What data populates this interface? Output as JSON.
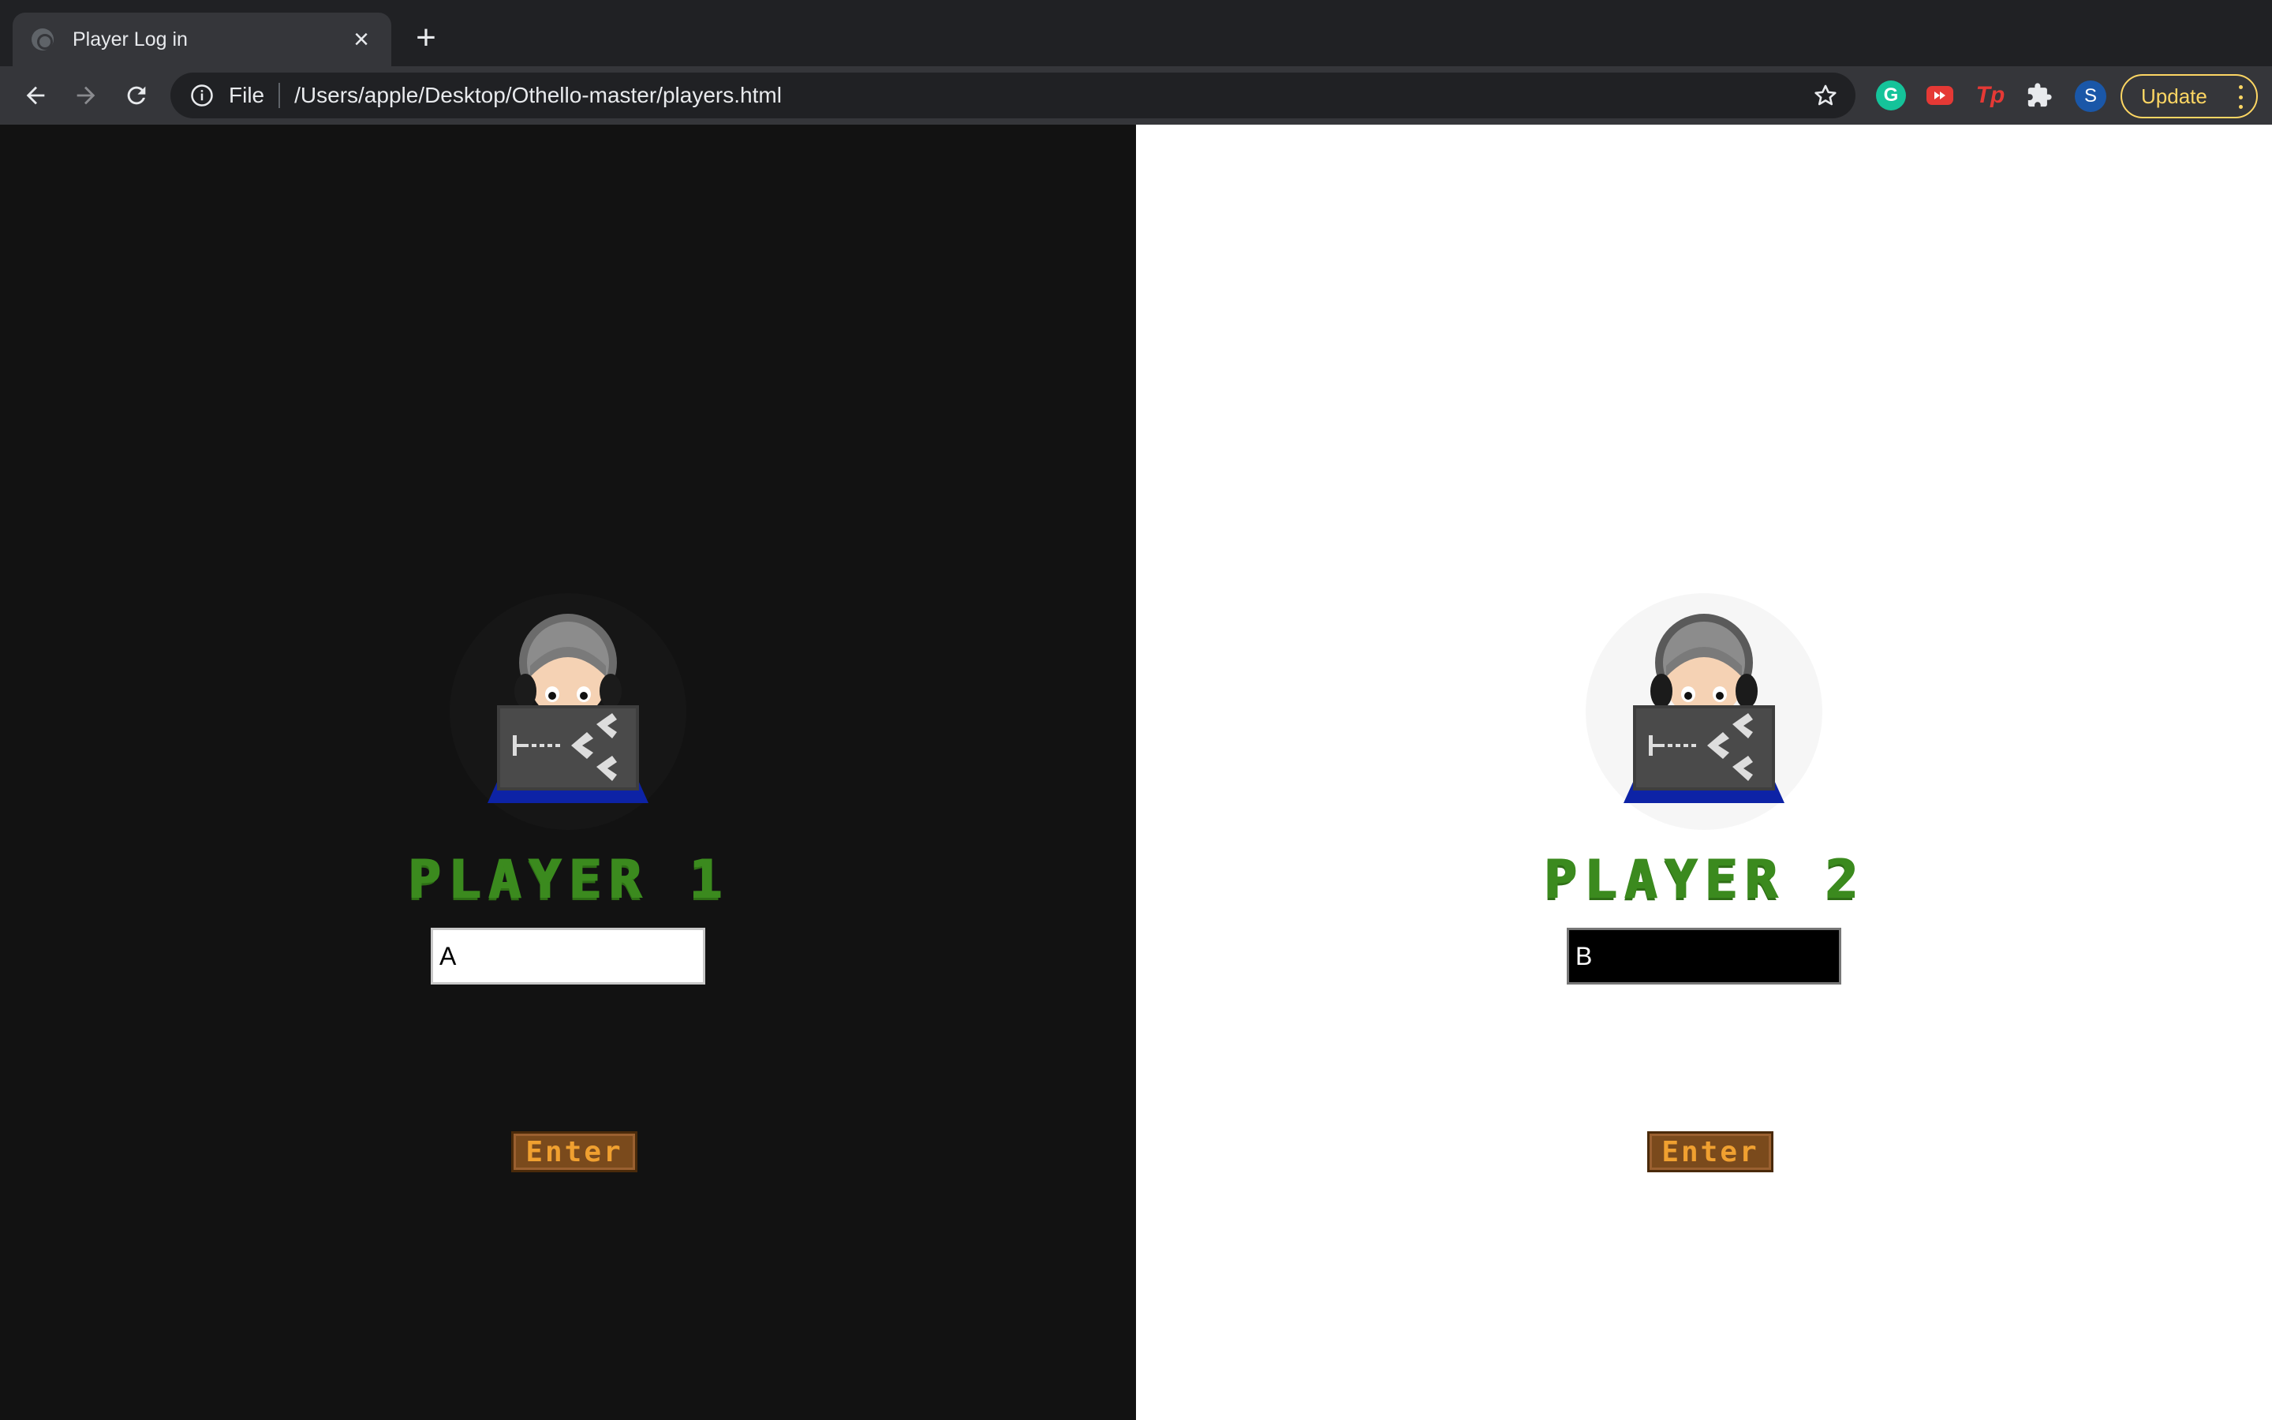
{
  "browser": {
    "tab_title": "Player Log in",
    "scheme_label": "File",
    "url": "/Users/apple/Desktop/Othello-master/players.html",
    "update_label": "Update",
    "avatar_initial": "S",
    "extensions": [
      "grammarly-icon",
      "youtube-icon",
      "tp-icon",
      "puzzle-icon"
    ],
    "grammarly_letter": "G",
    "tp_label": "Tp"
  },
  "players": [
    {
      "title": "PLAYER 1",
      "name_value": "A",
      "enter_label": "Enter"
    },
    {
      "title": "PLAYER 2",
      "name_value": "B",
      "enter_label": "Enter"
    }
  ],
  "colors": {
    "left_bg": "#121212",
    "right_bg": "#ffffff",
    "title_green": "#3b8a1e",
    "button_brown": "#7a4a1c",
    "button_text": "#f0a030"
  }
}
